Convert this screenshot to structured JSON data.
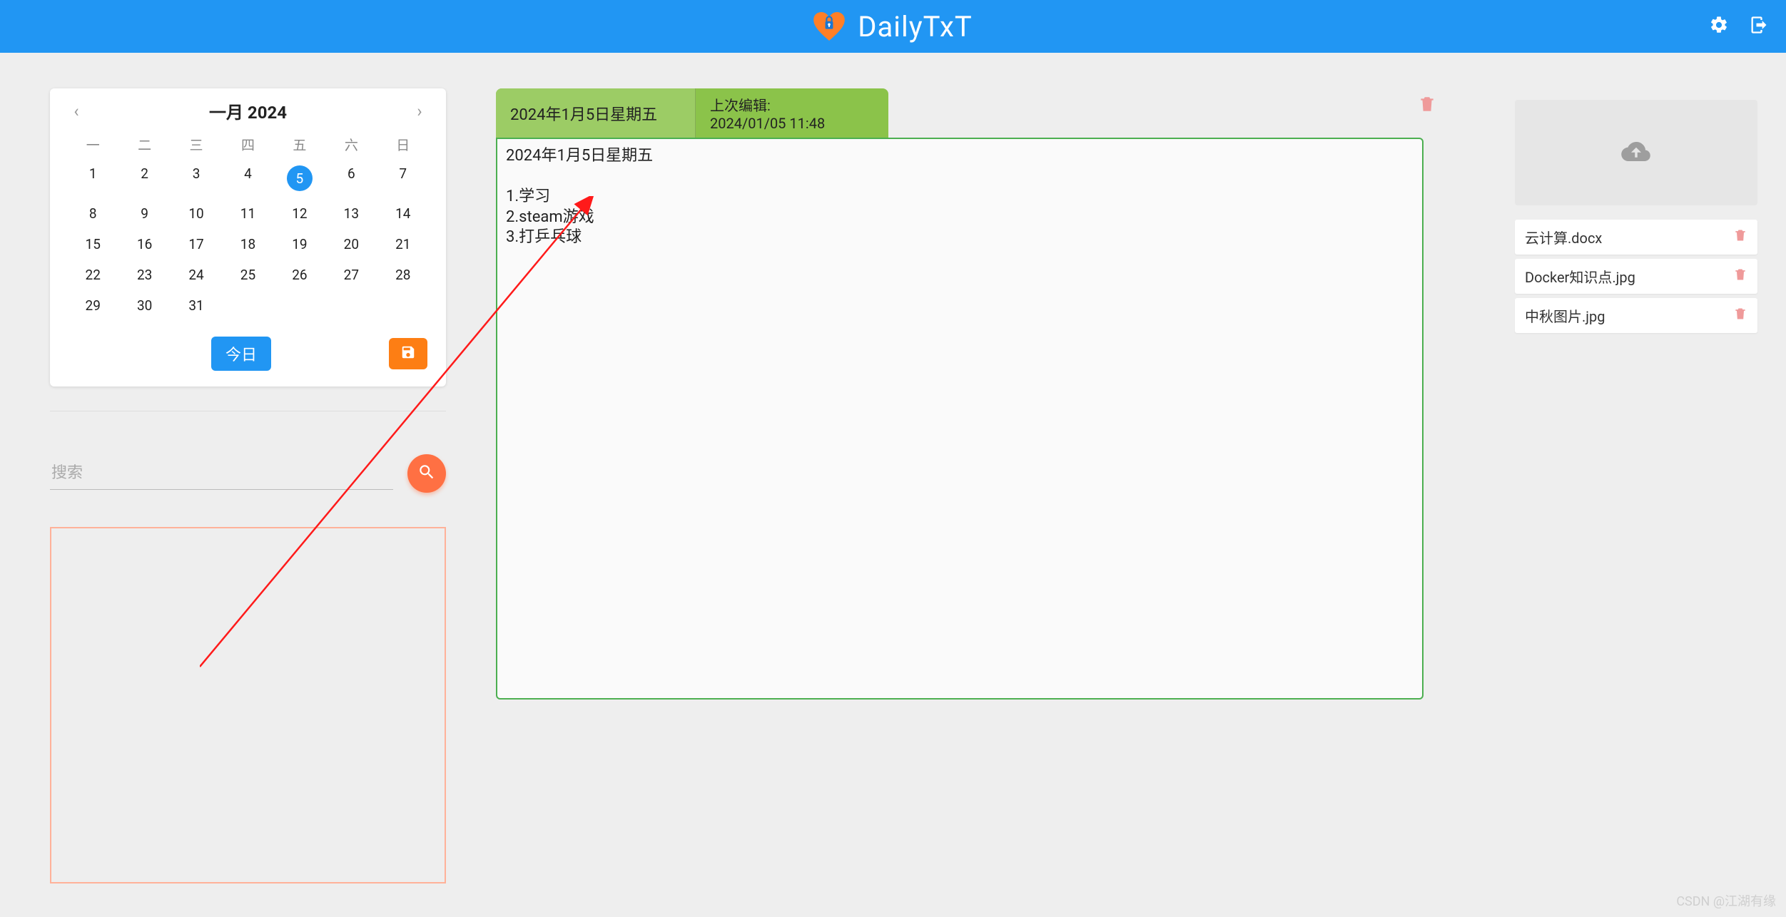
{
  "header": {
    "app_name": "DailyTxT"
  },
  "calendar": {
    "title": "一月 2024",
    "dow": [
      "一",
      "二",
      "三",
      "四",
      "五",
      "六",
      "日"
    ],
    "weeks": [
      [
        "1",
        "2",
        "3",
        "4",
        "5",
        "6",
        "7"
      ],
      [
        "8",
        "9",
        "10",
        "11",
        "12",
        "13",
        "14"
      ],
      [
        "15",
        "16",
        "17",
        "18",
        "19",
        "20",
        "21"
      ],
      [
        "22",
        "23",
        "24",
        "25",
        "26",
        "27",
        "28"
      ],
      [
        "29",
        "30",
        "31",
        "",
        "",
        "",
        ""
      ]
    ],
    "selected": "5",
    "today_label": "今日"
  },
  "search": {
    "placeholder": "搜索"
  },
  "entry": {
    "tab_date": "2024年1月5日星期五",
    "last_edit_label": "上次编辑:",
    "last_edit_value": "2024/01/05 11:48",
    "body": "2024年1月5日星期五\n\n1.学习\n2.steam游戏\n3.打乒乓球"
  },
  "files": {
    "items": [
      {
        "name": "云计算.docx"
      },
      {
        "name": "Docker知识点.jpg"
      },
      {
        "name": "中秋图片.jpg"
      }
    ]
  },
  "watermark": "CSDN @江湖有缘"
}
